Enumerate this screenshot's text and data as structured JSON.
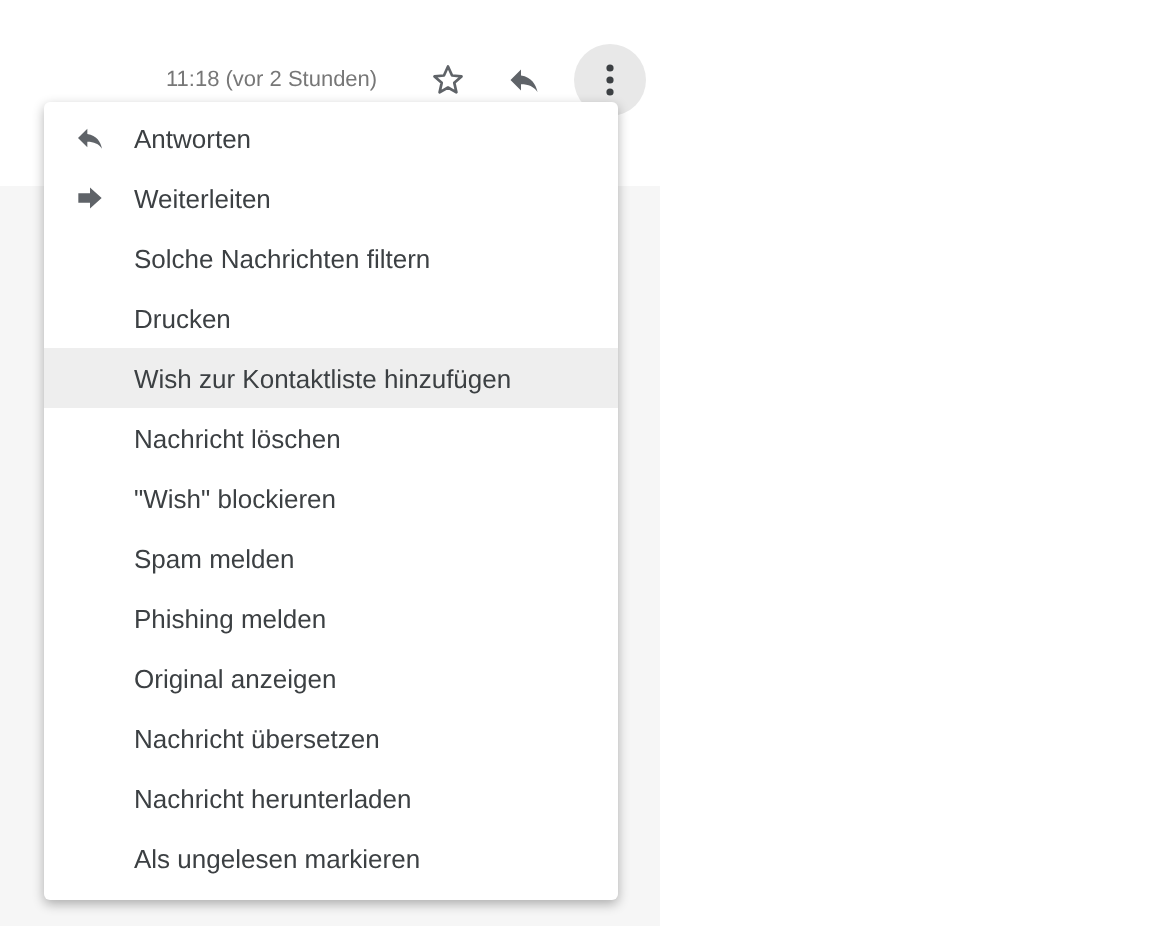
{
  "header": {
    "time": "11:18 (vor 2 Stunden)"
  },
  "menu": {
    "items": [
      {
        "label": "Antworten",
        "kind": "reply",
        "selected": false
      },
      {
        "label": "Weiterleiten",
        "kind": "forward",
        "selected": false
      },
      {
        "label": "Solche Nachrichten filtern",
        "kind": "plain",
        "selected": false
      },
      {
        "label": "Drucken",
        "kind": "plain",
        "selected": false
      },
      {
        "label": "Wish zur Kontaktliste hinzufügen",
        "kind": "plain",
        "selected": true
      },
      {
        "label": "Nachricht löschen",
        "kind": "plain",
        "selected": false
      },
      {
        "label": "\"Wish\" blockieren",
        "kind": "plain",
        "selected": false
      },
      {
        "label": "Spam melden",
        "kind": "plain",
        "selected": false
      },
      {
        "label": "Phishing melden",
        "kind": "plain",
        "selected": false
      },
      {
        "label": "Original anzeigen",
        "kind": "plain",
        "selected": false
      },
      {
        "label": "Nachricht übersetzen",
        "kind": "plain",
        "selected": false
      },
      {
        "label": "Nachricht herunterladen",
        "kind": "plain",
        "selected": false
      },
      {
        "label": "Als ungelesen markieren",
        "kind": "plain",
        "selected": false
      }
    ]
  }
}
